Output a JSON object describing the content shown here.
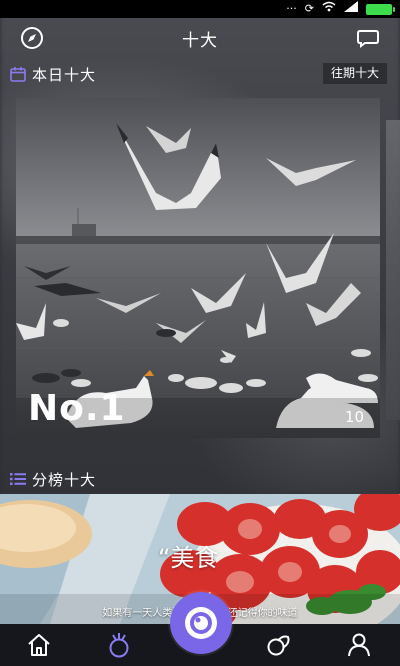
{
  "header": {
    "title": "十大"
  },
  "today": {
    "label": "本日十大",
    "past_button": "往期十大"
  },
  "hero": {
    "rank": "No.1",
    "count": "10"
  },
  "category": {
    "label": "分榜十大"
  },
  "banner": {
    "title": "“美食",
    "caption": "如果有一天人类没有██少我还记得你的味道"
  },
  "icons": {
    "compass": "compass-icon",
    "message": "chat-bubble-icon",
    "calendar": "calendar-icon",
    "list": "list-icon",
    "home": "home-icon",
    "ring": "ring-icon",
    "camera": "camera-lens-icon",
    "discover": "discover-icon",
    "profile": "profile-icon"
  },
  "colors": {
    "accent": "#7a67e8",
    "tab_active": "#8a7cf0",
    "tab_inactive": "#ffffff",
    "battery": "#3ddc4a"
  }
}
